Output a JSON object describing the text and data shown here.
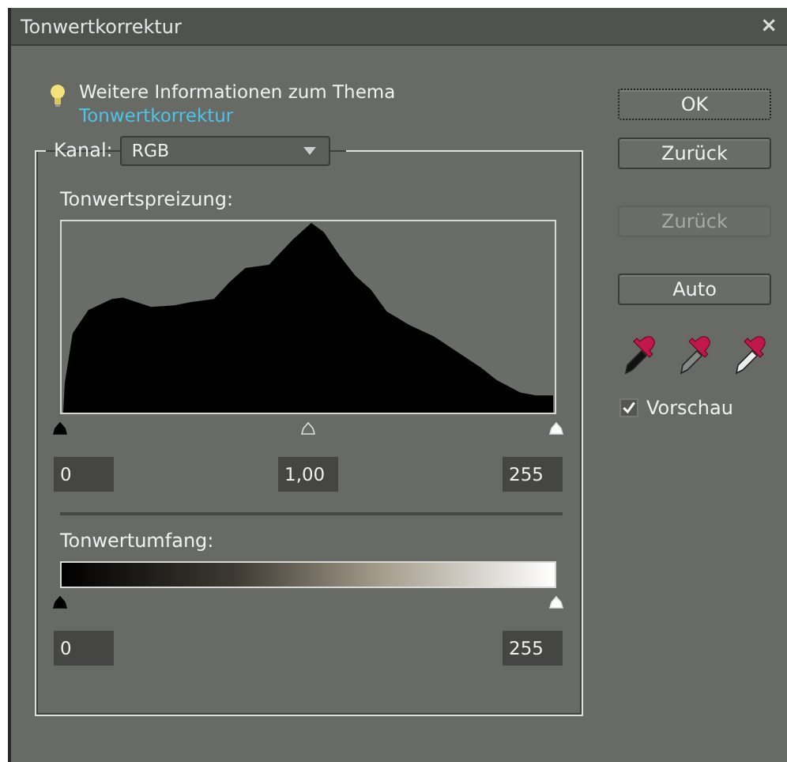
{
  "window": {
    "title": "Tonwertkorrektur",
    "close": "×"
  },
  "info": {
    "text": "Weitere Informationen zum Thema",
    "link": "Tonwertkorrektur"
  },
  "channel": {
    "label": "Kanal:",
    "value": "RGB"
  },
  "input_levels": {
    "label": "Tonwertspreizung:",
    "thumbs": [
      {
        "kind": "black"
      },
      {
        "kind": "gray"
      },
      {
        "kind": "white"
      }
    ],
    "fields": [
      "0",
      "1,00",
      "255"
    ]
  },
  "output_levels": {
    "label": "Tonwertumfang:",
    "fields": [
      "0",
      "255"
    ]
  },
  "buttons": [
    {
      "label": "OK",
      "disabled": false,
      "default": true
    },
    {
      "label": "Zurück",
      "disabled": false,
      "default": false
    },
    {
      "label": "Zurück",
      "disabled": true,
      "default": false
    },
    {
      "label": "Auto",
      "disabled": false,
      "default": false
    }
  ],
  "droppers": [
    {
      "kind": "black"
    },
    {
      "kind": "gray"
    },
    {
      "kind": "white"
    }
  ],
  "preview": {
    "label": "Vorschau",
    "checked": true
  }
}
